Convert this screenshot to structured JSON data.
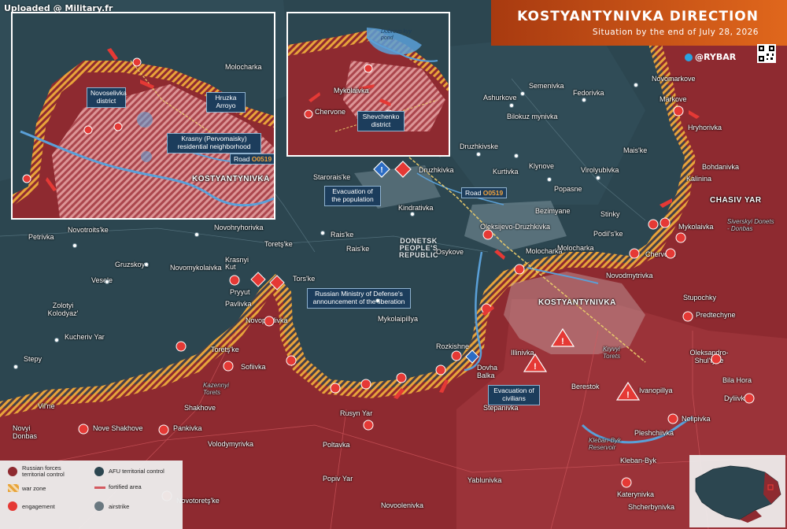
{
  "watermark": "Uploaded @ Military.fr",
  "header": {
    "title": "KOSTYANTYNIVKA DIRECTION",
    "subtitle": "Situation by the end of July 28, 2026",
    "brand": "@RYBAR",
    "brand_icon": "telegram-icon"
  },
  "colors": {
    "russian_control": "#8e2a30",
    "afu_control": "#2c4650",
    "war_zone": "#e8a43a",
    "engagement": "#e53935",
    "accent": "#e0671c"
  },
  "region_label": "DONETSK PEOPLE'S REPUBLIC",
  "settlements": [
    {
      "name": "Molocharka"
    },
    {
      "name": "Semenivka"
    },
    {
      "name": "Novomarkove"
    },
    {
      "name": "Ashurkove"
    },
    {
      "name": "Fedorivka"
    },
    {
      "name": "Markove"
    },
    {
      "name": "Bilokuz mynivka"
    },
    {
      "name": "Hryhorivka"
    },
    {
      "name": "Druzhkivske"
    },
    {
      "name": "Mais'ke"
    },
    {
      "name": "Bohdanivka"
    },
    {
      "name": "Starorais'ke"
    },
    {
      "name": "Druzhkivka"
    },
    {
      "name": "Kurtivka"
    },
    {
      "name": "Klynove"
    },
    {
      "name": "Virolyubivka"
    },
    {
      "name": "Kalinina"
    },
    {
      "name": "Popasne"
    },
    {
      "name": "CHASIV YAR"
    },
    {
      "name": "Kindrativka"
    },
    {
      "name": "Bezimyane"
    },
    {
      "name": "Stinky"
    },
    {
      "name": "Podil's'ke"
    },
    {
      "name": "Mykolaivka"
    },
    {
      "name": "Novotroits'ke"
    },
    {
      "name": "Novohryhorivka"
    },
    {
      "name": "Petrivka"
    },
    {
      "name": "Toretş'ke"
    },
    {
      "name": "Rais'ke"
    },
    {
      "name": "Oleksijevo-Druzhkivka"
    },
    {
      "name": "Chervone"
    },
    {
      "name": "Gruzskoye"
    },
    {
      "name": "Novomykolaivka"
    },
    {
      "name": "Krasnyi Kut"
    },
    {
      "name": "Tors'ke"
    },
    {
      "name": "Osykove"
    },
    {
      "name": "Molocharka"
    },
    {
      "name": "Novodmytrivka"
    },
    {
      "name": "Vesele"
    },
    {
      "name": "Pryyut"
    },
    {
      "name": "Stupochky"
    },
    {
      "name": "Zolotyi Kolodyaz'"
    },
    {
      "name": "Pavlivka"
    },
    {
      "name": "KOSTYANTYNIVKA"
    },
    {
      "name": "Predtechyne"
    },
    {
      "name": "Novopavlivka"
    },
    {
      "name": "Mykolaipillya"
    },
    {
      "name": "Kucheriv Yar"
    },
    {
      "name": "Oleksandro-Shul'tyne"
    },
    {
      "name": "Toretş'ke"
    },
    {
      "name": "Rozkishne"
    },
    {
      "name": "Illinivka"
    },
    {
      "name": "Stepy"
    },
    {
      "name": "Sofiivka"
    },
    {
      "name": "Dovha Balka"
    },
    {
      "name": "Bila Hora"
    },
    {
      "name": "Berestok"
    },
    {
      "name": "Ivanopillya"
    },
    {
      "name": "Dyliivka"
    },
    {
      "name": "Vil'ne"
    },
    {
      "name": "Shakhove"
    },
    {
      "name": "Rusyn Yar"
    },
    {
      "name": "Stepanivka"
    },
    {
      "name": "Novyi Donbas"
    },
    {
      "name": "Nove Shakhove"
    },
    {
      "name": "Pankivka"
    },
    {
      "name": "Nelipivka"
    },
    {
      "name": "Pleshchiivka"
    },
    {
      "name": "Volodymyrivka"
    },
    {
      "name": "Poltavka"
    },
    {
      "name": "Kleban-Byk"
    },
    {
      "name": "Popiv Yar"
    },
    {
      "name": "Yablunivka"
    },
    {
      "name": "Katerynivka"
    },
    {
      "name": "Shcherbynivka"
    },
    {
      "name": "Novotoretş'ke"
    },
    {
      "name": "Novoolenivka"
    }
  ],
  "water_labels": [
    {
      "name": "Kazennyi Torets"
    },
    {
      "name": "Kryvyi Torets"
    },
    {
      "name": "Kleban-Byk Reservoir"
    },
    {
      "name": "Siverskyi Donets - Donbas"
    }
  ],
  "callouts": {
    "evacuation_population": "Evacuation of the population",
    "evacuation_civilians": "Evacuation of civilians",
    "ministry": "Russian Ministry of Defense's announcement of the liberation",
    "road_main_prefix": "Road",
    "road_main_code": "O0519"
  },
  "inset_left": {
    "labels": [
      {
        "name": "Molocharka"
      },
      {
        "name": "Novoselivka district"
      },
      {
        "name": "Hruzka Arroyo"
      },
      {
        "name": "Krasny (Pervomaisky) residential neighborhood"
      },
      {
        "name": "KOSTYANTYNIVKA"
      }
    ],
    "road_prefix": "Road",
    "road_code": "O0519"
  },
  "inset_right": {
    "labels": [
      {
        "name": "Dobrovo kyy pond"
      },
      {
        "name": "Mykolaivka"
      },
      {
        "name": "Chervone"
      },
      {
        "name": "Shevchenko district"
      }
    ]
  },
  "legend": [
    {
      "label": "Russian forces territorial control",
      "icon": "russian-control-swatch"
    },
    {
      "label": "AFU territorial control",
      "icon": "afu-control-swatch"
    },
    {
      "label": "war zone",
      "icon": "war-zone-swatch"
    },
    {
      "label": "fortified area",
      "icon": "fortified-line-swatch"
    },
    {
      "label": "engagement",
      "icon": "engagement-icon"
    },
    {
      "label": "airstrike",
      "icon": "airstrike-icon"
    }
  ]
}
